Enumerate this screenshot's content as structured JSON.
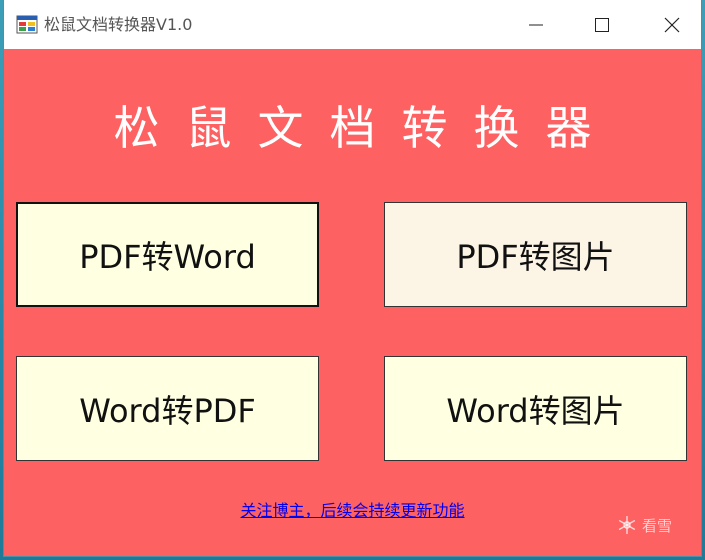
{
  "window": {
    "title": "松鼠文档转换器V1.0",
    "icon": "app-window-icon"
  },
  "controls": {
    "minimize_icon": "minimize-icon",
    "maximize_icon": "maximize-icon",
    "close_icon": "close-icon"
  },
  "main": {
    "heading": "松鼠文档转换器",
    "buttons": [
      {
        "label": "PDF转Word"
      },
      {
        "label": "PDF转图片"
      },
      {
        "label": "Word转PDF"
      },
      {
        "label": "Word转图片"
      }
    ],
    "footer_link": "关注博主，后续会持续更新功能"
  },
  "watermark": {
    "text": "看雪",
    "icon": "snowflake-icon"
  },
  "colors": {
    "window_bg": "#fe6161",
    "button_bg": "#ffffe1",
    "button_alt_bg": "#fcf4e4",
    "link": "#0000ee"
  }
}
